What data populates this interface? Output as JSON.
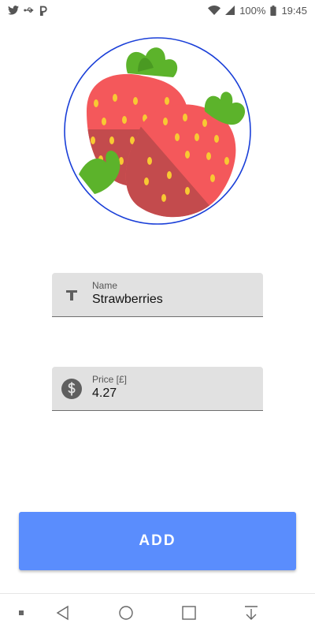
{
  "status_bar": {
    "left_icons": [
      "twitter-icon",
      "usb-icon",
      "pinterest-icon"
    ],
    "right_icons": [
      "wifi-icon",
      "signal-icon"
    ],
    "battery": "100%",
    "time": "19:45"
  },
  "image": {
    "subject": "strawberries-icon",
    "border_color": "#1a3fd8"
  },
  "form": {
    "name": {
      "label": "Name",
      "value": "Strawberries",
      "icon": "text-format-icon"
    },
    "price": {
      "label": "Price [£]",
      "value": "4.27",
      "icon": "dollar-circle-icon"
    }
  },
  "add_button": {
    "label": "ADD",
    "color": "#5a8dfd"
  },
  "nav_bar": {
    "items": [
      "menu-dot-icon",
      "back-icon",
      "home-icon",
      "recents-icon",
      "download-icon"
    ]
  }
}
